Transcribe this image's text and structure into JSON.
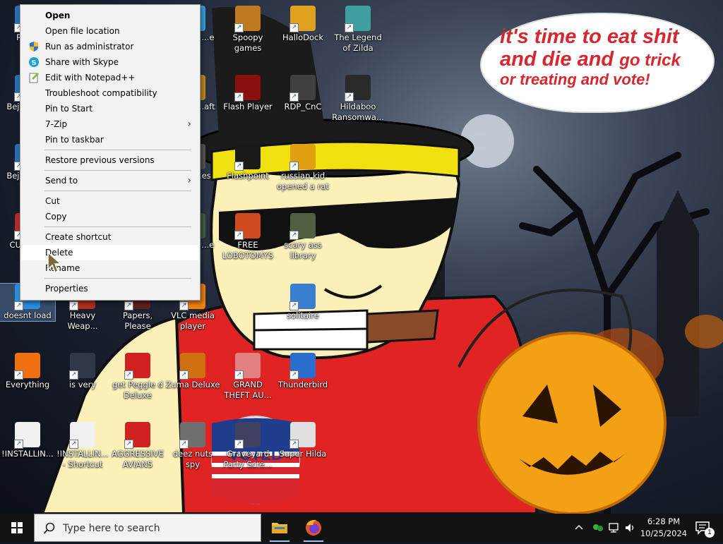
{
  "bubble": {
    "line1": "it's time to eat shit",
    "line2a": "and die and ",
    "line2b": "go trick",
    "line3": "or treating and vote!"
  },
  "badge": {
    "text": "VOTED"
  },
  "context_menu": {
    "items": [
      {
        "label": "Open",
        "bold": true
      },
      {
        "label": "Open file location"
      },
      {
        "label": "Run as administrator",
        "icon": "shield-icon"
      },
      {
        "label": "Share with Skype",
        "icon": "skype-icon"
      },
      {
        "label": "Edit with Notepad++",
        "icon": "notepadpp-icon"
      },
      {
        "label": "Troubleshoot compatibility"
      },
      {
        "label": "Pin to Start"
      },
      {
        "label": "7-Zip",
        "submenu": true
      },
      {
        "label": "Pin to taskbar"
      },
      {
        "label": "Restore previous versions"
      },
      {
        "label": "Send to",
        "submenu": true
      },
      {
        "label": "Cut"
      },
      {
        "label": "Copy"
      },
      {
        "label": "Create shortcut"
      },
      {
        "label": "Delete",
        "hover": true
      },
      {
        "label": "Rename"
      },
      {
        "label": "Properties"
      }
    ],
    "submenu_arrow": "›"
  },
  "desktop": {
    "icons": [
      {
        "label": "Rec...",
        "color": "#2a6fb5"
      },
      {
        "label": "Bejeweled D...",
        "color": "#2a6fb5"
      },
      {
        "label": "Bejeweled D...",
        "color": "#2a6fb5"
      },
      {
        "label": "CU... D...",
        "color": "#b52a2a"
      },
      {
        "label": "...ights ...e",
        "color": "#3aa0e0"
      },
      {
        "label": "World ...aft",
        "color": "#c08a20"
      },
      {
        "label": "...vs ...es",
        "color": "#555"
      },
      {
        "label": "...lania ...e",
        "color": "#406040"
      },
      {
        "label": "Spoopy games",
        "color": "#c07a20"
      },
      {
        "label": "Flash Player",
        "color": "#8a1010"
      },
      {
        "label": "Flashpoint",
        "color": "#1a1a1a"
      },
      {
        "label": "FREE LOBOTOMYS",
        "color": "#d04a20"
      },
      {
        "label": "HalloDock",
        "color": "#e0a020"
      },
      {
        "label": "RDP_CnC",
        "color": "#404040"
      },
      {
        "label": "russian kid opened a rat",
        "color": "#e0a010"
      },
      {
        "label": "scary ass library",
        "color": "#506040"
      },
      {
        "label": "solitaire",
        "color": "#3a7fd0"
      },
      {
        "label": "Thunderbird",
        "color": "#2a6fd0"
      },
      {
        "label": "The Legend of Zilda",
        "color": "#40a0a0"
      },
      {
        "label": "Hildaboo Ransomwa...",
        "color": "#2a2a2a"
      },
      {
        "label": "doesnt load",
        "color": "#2a8fe0"
      },
      {
        "label": "Heavy Weap...",
        "color": "#b03020"
      },
      {
        "label": "Papers, Please",
        "color": "#602020"
      },
      {
        "label": "VLC media player",
        "color": "#f08010"
      },
      {
        "label": "Everything",
        "color": "#f07010"
      },
      {
        "label": "is very",
        "color": "#303848"
      },
      {
        "label": "get Peggle d Deluxe",
        "color": "#d02020"
      },
      {
        "label": "Zuma Deluxe",
        "color": "#d07010"
      },
      {
        "label": "GRAND THEFT AU...",
        "color": "#e08080"
      },
      {
        "label": "!INSTALLIN...",
        "color": "#f0f0f0"
      },
      {
        "label": "!INSTALLIN... - Shortcut",
        "color": "#f0f0f0"
      },
      {
        "label": "AGGRESSIVE AVIANS",
        "color": "#d02020"
      },
      {
        "label": "deez nuts spy",
        "color": "#707070"
      },
      {
        "label": "Graveyard Party Scre...",
        "color": "#404060"
      },
      {
        "label": "Super Hilda",
        "color": "#e0e0e0"
      }
    ]
  },
  "taskbar": {
    "search_placeholder": "Type here to search",
    "time": "6:28 PM",
    "date": "10/25/2024",
    "notification_count": "1"
  }
}
